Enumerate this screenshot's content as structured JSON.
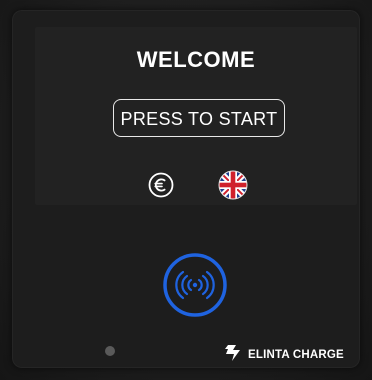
{
  "screen": {
    "title": "WELCOME",
    "start_button_label": "PRESS TO START",
    "currency_icon": "euro-icon",
    "language_icon": "uk-flag-icon"
  },
  "device": {
    "nfc_icon": "contactless-icon",
    "brand_name": "ELINTA CHARGE",
    "brand_icon": "elinta-logo",
    "accent_color": "#1f63e0"
  }
}
